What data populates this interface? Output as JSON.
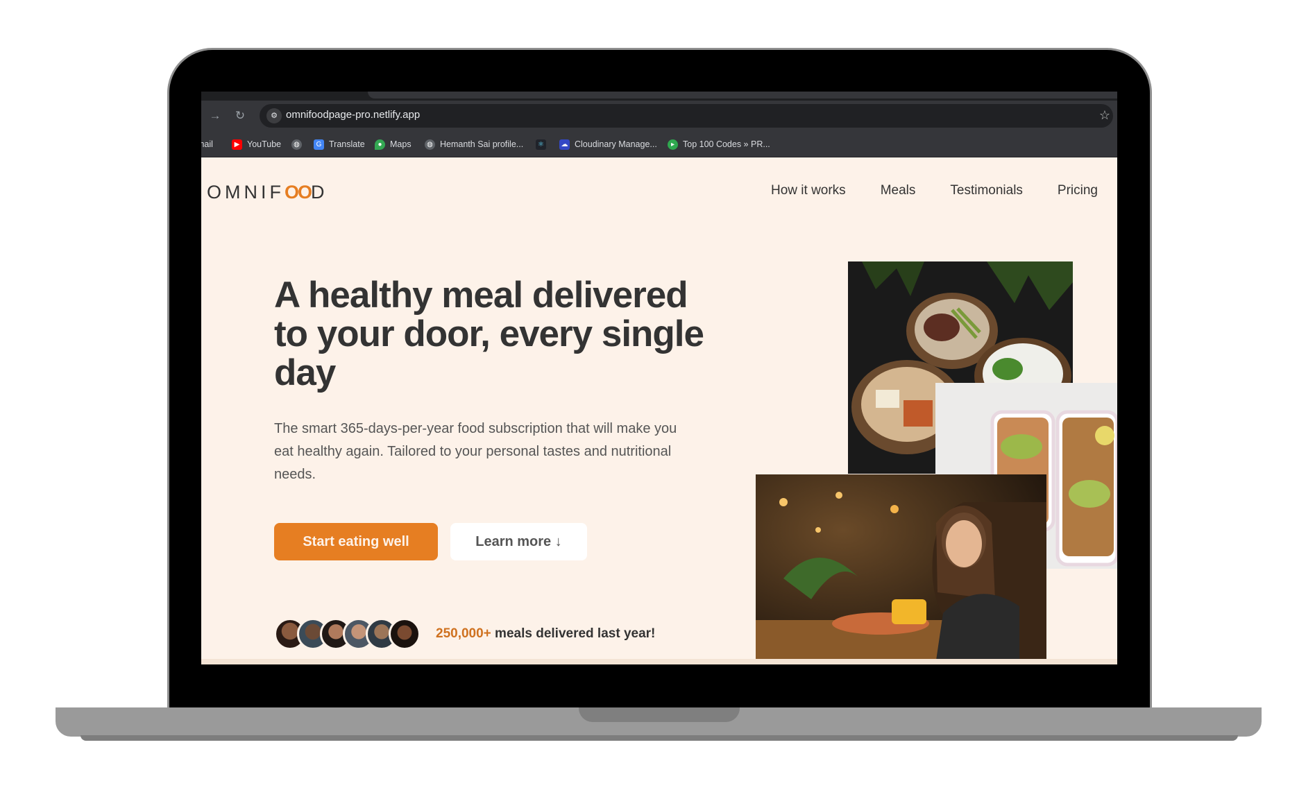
{
  "browser": {
    "url": "omnifoodpage-pro.netlify.app",
    "bookmarks": [
      {
        "label": "mail",
        "icon": "gmail-icon"
      },
      {
        "label": "YouTube",
        "icon": "youtube-icon"
      },
      {
        "label": "",
        "icon": "globe-icon"
      },
      {
        "label": "Translate",
        "icon": "translate-icon"
      },
      {
        "label": "Maps",
        "icon": "maps-icon"
      },
      {
        "label": "Hemanth Sai profile...",
        "icon": "globe-icon"
      },
      {
        "label": "",
        "icon": "react-icon"
      },
      {
        "label": "Cloudinary Manage...",
        "icon": "cloudinary-icon"
      },
      {
        "label": "Top 100 Codes » PR...",
        "icon": "code-icon"
      }
    ]
  },
  "site": {
    "logo_left": "OMNIF",
    "logo_oo": "OO",
    "logo_right": "D",
    "nav": [
      "How it works",
      "Meals",
      "Testimonials",
      "Pricing"
    ]
  },
  "hero": {
    "title": "A healthy meal delivered to your door, every single day",
    "description": "The smart 365-days-per-year food subscription that will make you eat healthy again. Tailored to your personal tastes and nutritional needs.",
    "primary_cta": "Start eating well",
    "secondary_cta": "Learn more ↓",
    "delivered_count": "250,000+",
    "delivered_text": " meals delivered last year!"
  },
  "colors": {
    "brand": "#e67e22",
    "page_bg": "#fdf2e9",
    "text": "#333333"
  }
}
